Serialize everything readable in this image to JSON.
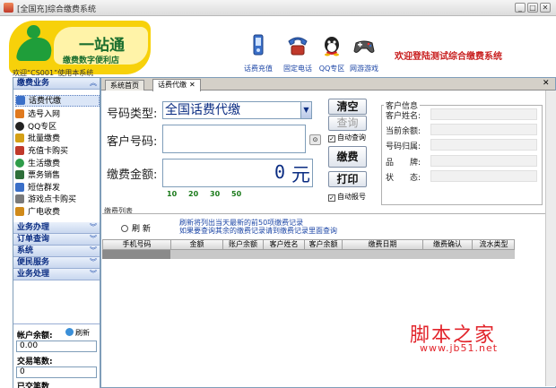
{
  "window": {
    "title": "[全国充]综合缴费系统",
    "buttons": [
      "_",
      "□",
      "✕"
    ]
  },
  "header": {
    "logo_title": "一站通",
    "logo_subtitle": "缴费数字便利店",
    "user_welcome": "欢迎“CS001”使用本系统",
    "welcome": "欢迎登陆测试综合缴费系统",
    "toolbar": [
      {
        "label": "话费充值",
        "icon": "mobile-phone-icon"
      },
      {
        "label": "固定电话",
        "icon": "landline-phone-icon"
      },
      {
        "label": "QQ专区",
        "icon": "qq-penguin-icon"
      },
      {
        "label": "网游游戏",
        "icon": "gamepad-icon"
      }
    ]
  },
  "sidebar": {
    "section_title": "缴费业务",
    "items": [
      {
        "label": "话费代缴",
        "icon": "phone-icon",
        "color": "#3a6fc8",
        "selected": true
      },
      {
        "label": "选号入网",
        "icon": "sim-icon",
        "color": "#e07a1f"
      },
      {
        "label": "QQ专区",
        "icon": "qq-icon",
        "color": "#222222"
      },
      {
        "label": "批量缴费",
        "icon": "batch-icon",
        "color": "#d4a017"
      },
      {
        "label": "充值卡购买",
        "icon": "card-icon",
        "color": "#c0392b"
      },
      {
        "label": "生活缴费",
        "icon": "life-icon",
        "color": "#2e9c4a"
      },
      {
        "label": "票务销售",
        "icon": "ticket-icon",
        "color": "#2e6f3a"
      },
      {
        "label": "短信群发",
        "icon": "sms-icon",
        "color": "#3a6fc8"
      },
      {
        "label": "游戏点卡购买",
        "icon": "game-card-icon",
        "color": "#7a7a7a"
      },
      {
        "label": "广电收费",
        "icon": "tv-icon",
        "color": "#d08a1a"
      }
    ],
    "groups": [
      {
        "label": "业务办理"
      },
      {
        "label": "订单查询"
      },
      {
        "label": "系统"
      },
      {
        "label": "便民服务"
      },
      {
        "label": "业务处理"
      }
    ],
    "balance_label": "帐户余额:",
    "refresh_label": "刷新",
    "balance_value": "0.00",
    "tx_label": "交易笔数:",
    "tx_value": "0",
    "tx_more": "已交笔数"
  },
  "tabs": [
    {
      "label": "系统首页"
    },
    {
      "label": "话费代缴",
      "active": true
    }
  ],
  "form": {
    "number_type_label": "号码类型:",
    "number_type_value": "全国话费代缴",
    "customer_number_label": "客户号码:",
    "amount_label": "缴费金额:",
    "amount_value": "0",
    "amount_unit": "元",
    "quick_amounts": [
      "10",
      "20",
      "30",
      "50"
    ]
  },
  "actions": {
    "clear": "清空",
    "query": "查询",
    "auto_query": "自动查询",
    "pay": "缴费",
    "print": "打印",
    "auto_report": "自动报号"
  },
  "customer_info": {
    "legend": "客户信息",
    "fields": [
      {
        "label": "客户姓名:"
      },
      {
        "label": "当前余额:"
      },
      {
        "label": "号码归属:"
      },
      {
        "label": "品　　牌:"
      },
      {
        "label": "状　　态:"
      }
    ]
  },
  "list": {
    "title": "缴费列表",
    "refresh": "刷 新",
    "note1": "刷新将列出当天最新的前50项缴费记录",
    "note2": "如果要查询其余的缴费记录请到缴费记录里面查询",
    "columns": [
      "手机号码",
      "金额",
      "账户余额",
      "客户姓名",
      "客户余额",
      "缴费日期",
      "缴费确认",
      "流水类型"
    ]
  },
  "watermark": {
    "text": "脚本之家",
    "url": "www.jb51.net"
  }
}
